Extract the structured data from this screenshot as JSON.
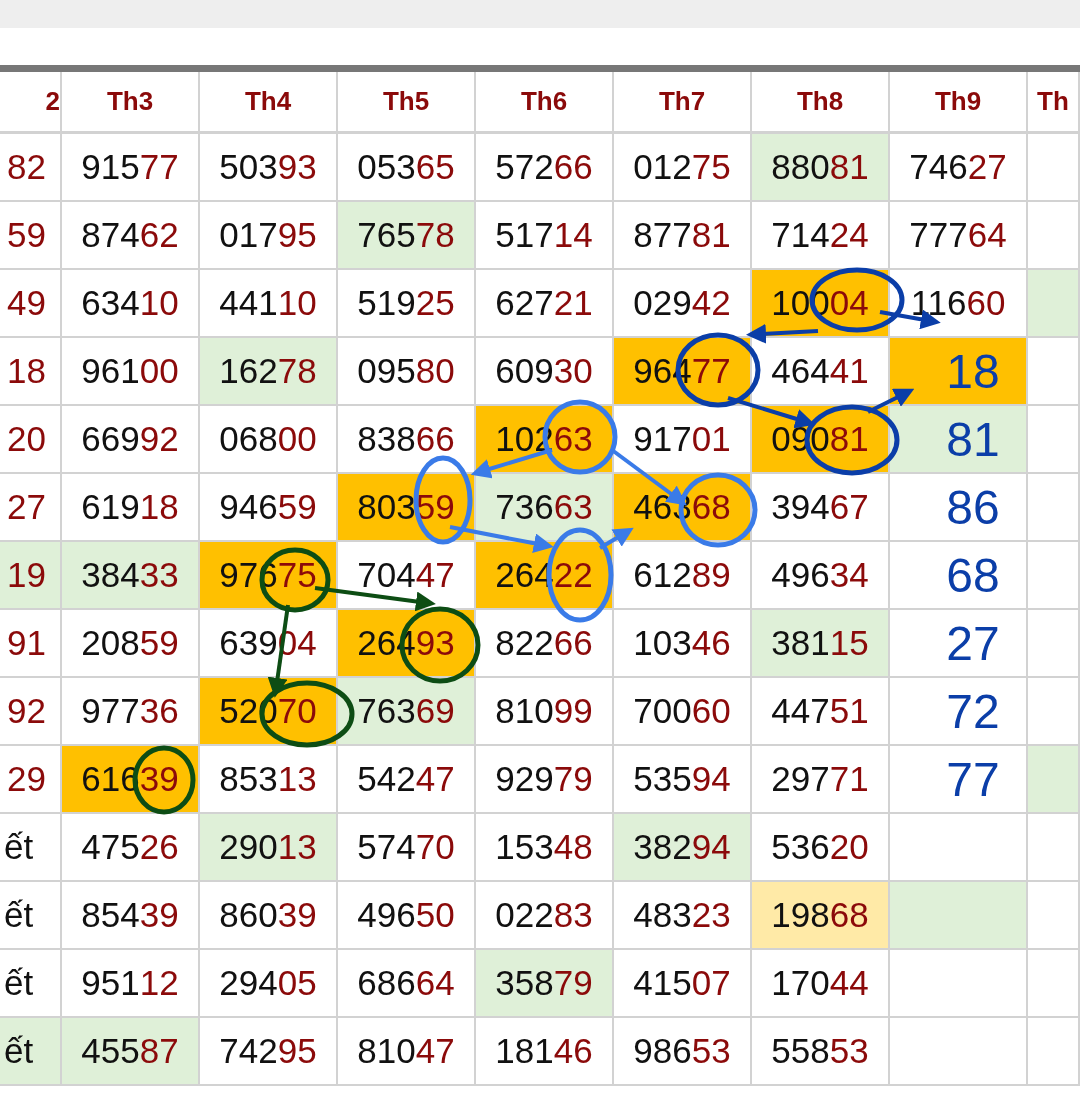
{
  "table": {
    "columns": [
      "2",
      "Th3",
      "Th4",
      "Th5",
      "Th6",
      "Th7",
      "Th8",
      "Th9",
      "Th"
    ],
    "rows": [
      {
        "cells": [
          {
            "kind": "tail",
            "text": "82"
          },
          {
            "kind": "number",
            "head": "915",
            "tail": "77"
          },
          {
            "kind": "number",
            "head": "503",
            "tail": "93"
          },
          {
            "kind": "number",
            "head": "053",
            "tail": "65"
          },
          {
            "kind": "number",
            "head": "572",
            "tail": "66"
          },
          {
            "kind": "number",
            "head": "012",
            "tail": "75"
          },
          {
            "kind": "number",
            "head": "880",
            "tail": "81",
            "color": "#dff0d8"
          },
          {
            "kind": "number",
            "head": "746",
            "tail": "27"
          },
          {
            "kind": "empty"
          }
        ]
      },
      {
        "cells": [
          {
            "kind": "tail",
            "text": "59"
          },
          {
            "kind": "number",
            "head": "874",
            "tail": "62"
          },
          {
            "kind": "number",
            "head": "017",
            "tail": "95"
          },
          {
            "kind": "number",
            "head": "765",
            "tail": "78",
            "color": "#dff0d8"
          },
          {
            "kind": "number",
            "head": "517",
            "tail": "14"
          },
          {
            "kind": "number",
            "head": "877",
            "tail": "81"
          },
          {
            "kind": "number",
            "head": "714",
            "tail": "24"
          },
          {
            "kind": "number",
            "head": "777",
            "tail": "64"
          },
          {
            "kind": "empty"
          }
        ]
      },
      {
        "cells": [
          {
            "kind": "tail",
            "text": "49"
          },
          {
            "kind": "number",
            "head": "634",
            "tail": "10"
          },
          {
            "kind": "number",
            "head": "441",
            "tail": "10"
          },
          {
            "kind": "number",
            "head": "519",
            "tail": "25"
          },
          {
            "kind": "number",
            "head": "627",
            "tail": "21"
          },
          {
            "kind": "number",
            "head": "029",
            "tail": "42"
          },
          {
            "kind": "number",
            "head": "100",
            "tail": "04",
            "color": "#ffc000"
          },
          {
            "kind": "number",
            "head": "116",
            "tail": "60"
          },
          {
            "kind": "empty",
            "color": "#dff0d8"
          }
        ]
      },
      {
        "cells": [
          {
            "kind": "tail",
            "text": "18"
          },
          {
            "kind": "number",
            "head": "961",
            "tail": "00"
          },
          {
            "kind": "number",
            "head": "162",
            "tail": "78",
            "color": "#dff0d8"
          },
          {
            "kind": "number",
            "head": "095",
            "tail": "80"
          },
          {
            "kind": "number",
            "head": "609",
            "tail": "30"
          },
          {
            "kind": "number",
            "head": "964",
            "tail": "77",
            "color": "#ffc000"
          },
          {
            "kind": "number",
            "head": "464",
            "tail": "41"
          },
          {
            "kind": "note",
            "text": "18",
            "color": "#ffc000"
          },
          {
            "kind": "empty"
          }
        ]
      },
      {
        "cells": [
          {
            "kind": "tail",
            "text": "20"
          },
          {
            "kind": "number",
            "head": "669",
            "tail": "92"
          },
          {
            "kind": "number",
            "head": "068",
            "tail": "00"
          },
          {
            "kind": "number",
            "head": "838",
            "tail": "66"
          },
          {
            "kind": "number",
            "head": "102",
            "tail": "63",
            "color": "#ffc000"
          },
          {
            "kind": "number",
            "head": "917",
            "tail": "01"
          },
          {
            "kind": "number",
            "head": "090",
            "tail": "81",
            "color": "#ffc000"
          },
          {
            "kind": "note",
            "text": "81",
            "color": "#dff0d8"
          },
          {
            "kind": "empty"
          }
        ]
      },
      {
        "cells": [
          {
            "kind": "tail",
            "text": "27"
          },
          {
            "kind": "number",
            "head": "619",
            "tail": "18"
          },
          {
            "kind": "number",
            "head": "946",
            "tail": "59"
          },
          {
            "kind": "number",
            "head": "803",
            "tail": "59",
            "color": "#ffc000"
          },
          {
            "kind": "number",
            "head": "736",
            "tail": "63",
            "color": "#dff0d8"
          },
          {
            "kind": "number",
            "head": "463",
            "tail": "68",
            "color": "#ffc000"
          },
          {
            "kind": "number",
            "head": "394",
            "tail": "67"
          },
          {
            "kind": "note",
            "text": "86"
          },
          {
            "kind": "empty"
          }
        ]
      },
      {
        "cells": [
          {
            "kind": "tail",
            "text": "19",
            "color": "#dff0d8"
          },
          {
            "kind": "number",
            "head": "384",
            "tail": "33",
            "color": "#dff0d8"
          },
          {
            "kind": "number",
            "head": "976",
            "tail": "75",
            "color": "#ffc000"
          },
          {
            "kind": "number",
            "head": "704",
            "tail": "47"
          },
          {
            "kind": "number",
            "head": "264",
            "tail": "22",
            "color": "#ffc000"
          },
          {
            "kind": "number",
            "head": "612",
            "tail": "89"
          },
          {
            "kind": "number",
            "head": "496",
            "tail": "34"
          },
          {
            "kind": "note",
            "text": "68"
          },
          {
            "kind": "empty"
          }
        ]
      },
      {
        "cells": [
          {
            "kind": "tail",
            "text": "91"
          },
          {
            "kind": "number",
            "head": "208",
            "tail": "59"
          },
          {
            "kind": "number",
            "head": "639",
            "tail": "04"
          },
          {
            "kind": "number",
            "head": "264",
            "tail": "93",
            "color": "#ffc000"
          },
          {
            "kind": "number",
            "head": "822",
            "tail": "66"
          },
          {
            "kind": "number",
            "head": "103",
            "tail": "46"
          },
          {
            "kind": "number",
            "head": "381",
            "tail": "15",
            "color": "#dff0d8"
          },
          {
            "kind": "note",
            "text": "27"
          },
          {
            "kind": "empty"
          }
        ]
      },
      {
        "cells": [
          {
            "kind": "tail",
            "text": "92"
          },
          {
            "kind": "number",
            "head": "977",
            "tail": "36"
          },
          {
            "kind": "number",
            "head": "520",
            "tail": "70",
            "color": "#ffc000"
          },
          {
            "kind": "number",
            "head": "763",
            "tail": "69",
            "color": "#dff0d8"
          },
          {
            "kind": "number",
            "head": "810",
            "tail": "99"
          },
          {
            "kind": "number",
            "head": "700",
            "tail": "60"
          },
          {
            "kind": "number",
            "head": "447",
            "tail": "51"
          },
          {
            "kind": "note",
            "text": "72"
          },
          {
            "kind": "empty"
          }
        ]
      },
      {
        "cells": [
          {
            "kind": "tail",
            "text": "29"
          },
          {
            "kind": "number",
            "head": "616",
            "tail": "39",
            "color": "#ffc000"
          },
          {
            "kind": "number",
            "head": "853",
            "tail": "13"
          },
          {
            "kind": "number",
            "head": "542",
            "tail": "47"
          },
          {
            "kind": "number",
            "head": "929",
            "tail": "79"
          },
          {
            "kind": "number",
            "head": "535",
            "tail": "94"
          },
          {
            "kind": "number",
            "head": "297",
            "tail": "71"
          },
          {
            "kind": "note",
            "text": "77"
          },
          {
            "kind": "empty",
            "color": "#dff0d8"
          }
        ]
      },
      {
        "cells": [
          {
            "kind": "text",
            "text": "ết"
          },
          {
            "kind": "number",
            "head": "475",
            "tail": "26"
          },
          {
            "kind": "number",
            "head": "290",
            "tail": "13",
            "color": "#dff0d8"
          },
          {
            "kind": "number",
            "head": "574",
            "tail": "70"
          },
          {
            "kind": "number",
            "head": "153",
            "tail": "48"
          },
          {
            "kind": "number",
            "head": "382",
            "tail": "94",
            "color": "#dff0d8"
          },
          {
            "kind": "number",
            "head": "536",
            "tail": "20"
          },
          {
            "kind": "empty"
          },
          {
            "kind": "empty"
          }
        ]
      },
      {
        "cells": [
          {
            "kind": "text",
            "text": "ết"
          },
          {
            "kind": "number",
            "head": "854",
            "tail": "39"
          },
          {
            "kind": "number",
            "head": "860",
            "tail": "39"
          },
          {
            "kind": "number",
            "head": "496",
            "tail": "50"
          },
          {
            "kind": "number",
            "head": "022",
            "tail": "83"
          },
          {
            "kind": "number",
            "head": "483",
            "tail": "23"
          },
          {
            "kind": "number",
            "head": "198",
            "tail": "68",
            "color": "#ffeaa7"
          },
          {
            "kind": "empty",
            "color": "#dff0d8"
          },
          {
            "kind": "empty"
          }
        ]
      },
      {
        "cells": [
          {
            "kind": "text",
            "text": "ết"
          },
          {
            "kind": "number",
            "head": "951",
            "tail": "12"
          },
          {
            "kind": "number",
            "head": "294",
            "tail": "05"
          },
          {
            "kind": "number",
            "head": "686",
            "tail": "64"
          },
          {
            "kind": "number",
            "head": "358",
            "tail": "79",
            "color": "#dff0d8"
          },
          {
            "kind": "number",
            "head": "415",
            "tail": "07"
          },
          {
            "kind": "number",
            "head": "170",
            "tail": "44"
          },
          {
            "kind": "empty"
          },
          {
            "kind": "empty"
          }
        ]
      },
      {
        "cells": [
          {
            "kind": "text",
            "text": "ết",
            "color": "#dff0d8"
          },
          {
            "kind": "number",
            "head": "455",
            "tail": "87",
            "color": "#dff0d8"
          },
          {
            "kind": "number",
            "head": "742",
            "tail": "95"
          },
          {
            "kind": "number",
            "head": "810",
            "tail": "47"
          },
          {
            "kind": "number",
            "head": "181",
            "tail": "46"
          },
          {
            "kind": "number",
            "head": "986",
            "tail": "53"
          },
          {
            "kind": "number",
            "head": "558",
            "tail": "53"
          },
          {
            "kind": "empty"
          },
          {
            "kind": "empty"
          }
        ]
      }
    ]
  }
}
